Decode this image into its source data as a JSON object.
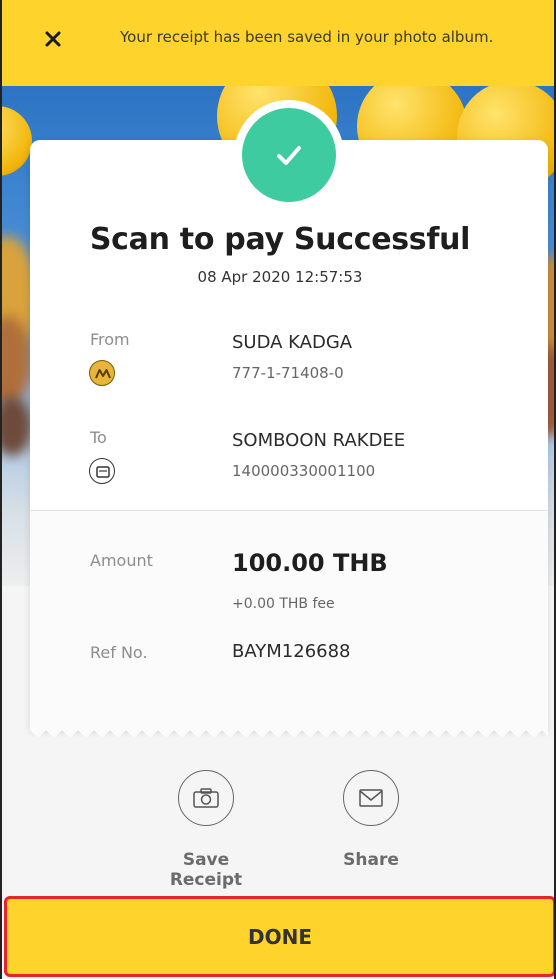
{
  "notification": {
    "message": "Your receipt has been saved in your photo album."
  },
  "receipt": {
    "title": "Scan to pay Successful",
    "datetime": "08 Apr 2020 12:57:53",
    "from": {
      "label": "From",
      "name": "SUDA KADGA",
      "account": "777-1-71408-0"
    },
    "to": {
      "label": "To",
      "name": "SOMBOON RAKDEE",
      "account": "140000330001100"
    },
    "amount": {
      "label": "Amount",
      "value": "100.00 THB",
      "fee": "+0.00 THB fee"
    },
    "ref": {
      "label": "Ref No.",
      "value": "BAYM126688"
    }
  },
  "actions": {
    "save_label": "Save Receipt",
    "share_label": "Share"
  },
  "done_label": "DONE",
  "colors": {
    "brand_yellow": "#fed32b",
    "success_green": "#3fcba0",
    "highlight_red": "#e8232b"
  }
}
